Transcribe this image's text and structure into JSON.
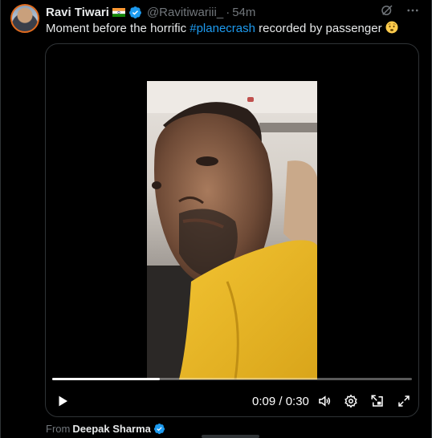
{
  "author": {
    "display_name": "Ravi Tiwari",
    "handle": "@Ravitiwariii_",
    "separator": "·",
    "time": "54m",
    "flag_icon": "india-flag-icon",
    "verified_icon": "verified-badge-icon",
    "verified_color": "#1d9bf0"
  },
  "header_icons": [
    "grok-icon",
    "more-icon"
  ],
  "tweet": {
    "text_before": "Moment before the horrific ",
    "hashtag": "#planecrash",
    "text_after": " recorded by passenger ",
    "emoji": "fearful-face-emoji",
    "hashtag_color": "#1d9bf0"
  },
  "video": {
    "current_time": "0:09",
    "duration": "0:30",
    "time_display": "0:09 / 0:30",
    "progress_fraction": 0.3,
    "controls": [
      "play-icon",
      "volume-icon",
      "settings-icon",
      "pip-icon",
      "fullscreen-icon"
    ]
  },
  "attribution": {
    "prefix": "From",
    "name": "Deepak Sharma"
  }
}
